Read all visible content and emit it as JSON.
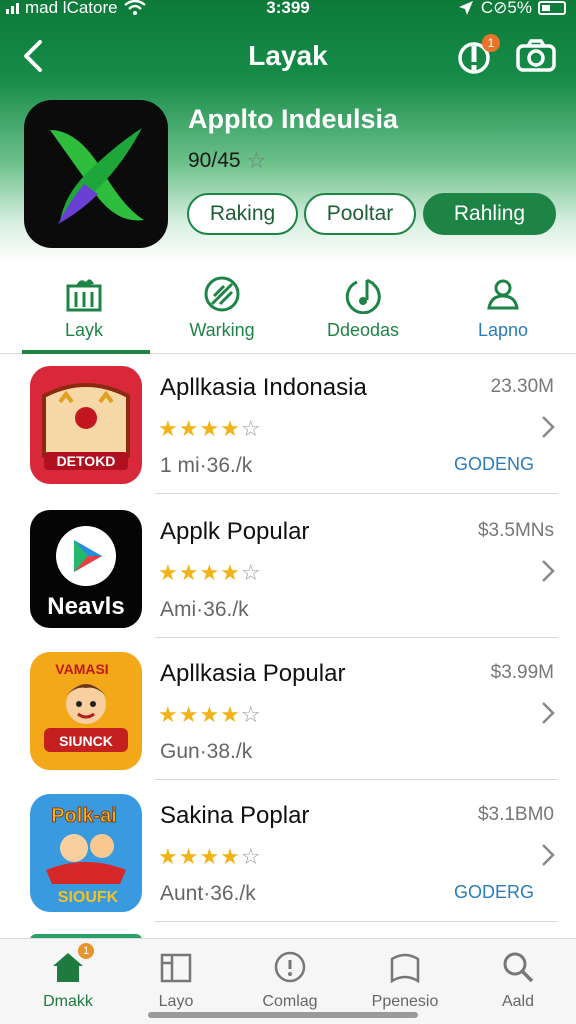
{
  "status_bar": {
    "carrier": "mad lCatore",
    "time": "3:399",
    "battery": "C⊘5%"
  },
  "header": {
    "title": "Layak",
    "alert_badge": "1"
  },
  "app": {
    "name": "Applto Indeulsia",
    "rating_text": "90/45",
    "rating_star": "☆"
  },
  "chips": [
    {
      "label": "Raking"
    },
    {
      "label": "Pooltar"
    },
    {
      "label": "Rahling"
    }
  ],
  "tabs": [
    {
      "label": "Layk",
      "icon": "bar-chart-icon"
    },
    {
      "label": "Warking",
      "icon": "globe-leaf-icon"
    },
    {
      "label": "Ddeodas",
      "icon": "music-note-icon"
    },
    {
      "label": "Lapno",
      "icon": "person-icon"
    }
  ],
  "apps": [
    {
      "name": "Apllkasia Indonasia",
      "stars": 4,
      "meta": "1 mi·36./k",
      "size": "23.30M",
      "action": "GODENG",
      "icon_text": "DETOKD",
      "icon": "game-icon"
    },
    {
      "name": "Applk Popular",
      "stars": 4,
      "meta": "Ami·36./k",
      "size": "$3.5MNs",
      "action": "",
      "icon_text": "Neavls",
      "icon": "play-store-icon"
    },
    {
      "name": "Apllkasia Popular",
      "stars": 3.5,
      "meta": "Gun·38./k",
      "size": "$3.99M",
      "action": "",
      "icon_text": "SIUNCK",
      "icon_text2": "VAMASI",
      "icon": "cartoon-game-icon"
    },
    {
      "name": "Sakina Poplar",
      "stars": 4,
      "meta": "Aunt·36./k",
      "size": "$3.1BM0",
      "action": "GODERG",
      "icon_text": "SIOUFK",
      "icon_text2": "Polk-ai",
      "icon": "cartoon-racer-icon"
    }
  ],
  "bottom_nav": [
    {
      "label": "Dmakk",
      "icon": "home-icon",
      "badge": "1"
    },
    {
      "label": "Layo",
      "icon": "book-icon"
    },
    {
      "label": "Comlag",
      "icon": "info-circle-icon"
    },
    {
      "label": "Ppenesio",
      "icon": "bookmark-icon"
    },
    {
      "label": "Aald",
      "icon": "search-icon"
    }
  ],
  "colors": {
    "brand_green": "#1e8446",
    "accent_blue": "#2b7cb8",
    "star_gold": "#f2b31a",
    "badge_orange": "#e8742a"
  }
}
